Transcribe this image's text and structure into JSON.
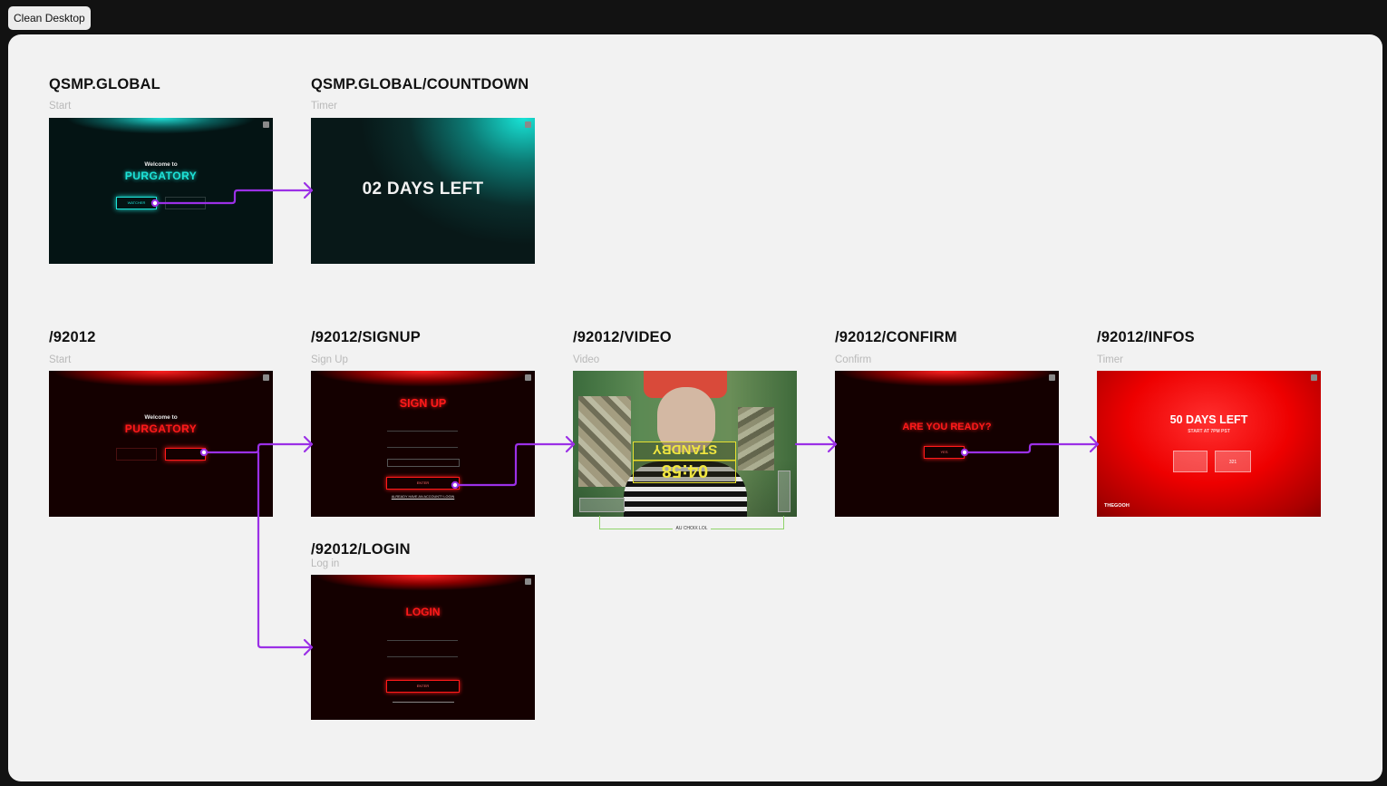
{
  "toolbar": {
    "clean_desktop_label": "Clean Desktop"
  },
  "frames": {
    "qsmp_global": {
      "title": "QSMP.GLOBAL",
      "subtitle": "Start",
      "welcome": "Welcome to",
      "purgatory": "PURGATORY",
      "button_label": "WATCHER"
    },
    "countdown": {
      "title": "QSMP.GLOBAL/COUNTDOWN",
      "subtitle": "Timer",
      "days_left": "02 DAYS LEFT"
    },
    "r92012": {
      "title": "/92012",
      "subtitle": "Start",
      "welcome": "Welcome to",
      "purgatory": "PURGATORY"
    },
    "signup": {
      "title": "/92012/SIGNUP",
      "subtitle": "Sign Up",
      "heading": "SIGN UP",
      "submit_label": "ENTER",
      "footer_link": "ALREADY HAVE AN ACCOUNT? LOGIN"
    },
    "video": {
      "title": "/92012/VIDEO",
      "subtitle": "Video",
      "standby": "STANDBY",
      "timer": "04:58",
      "bracket_label": "AU CHOIX LOL"
    },
    "confirm": {
      "title": "/92012/CONFIRM",
      "subtitle": "Confirm",
      "question": "ARE YOU READY?",
      "button_label": "YES"
    },
    "infos": {
      "title": "/92012/INFOS",
      "subtitle": "Timer",
      "days_left": "50 DAYS LEFT",
      "start_time": "START AT 7PM PST",
      "card2_value": "321",
      "username": "THEGOOH"
    },
    "login": {
      "title": "/92012/LOGIN",
      "subtitle": "Log in",
      "heading": "LOGIN",
      "submit_label": "ENTER"
    }
  },
  "colors": {
    "teal_accent": "#1de3d8",
    "red_accent": "#ff1a1a",
    "flow_arrow": "#9b30e6",
    "bracket_green": "#8fd46a",
    "canvas_bg": "#f2f2f2",
    "app_bg": "#121212"
  },
  "icons": {
    "close": "close-icon",
    "flow_connector": "flow-arrow-icon"
  }
}
